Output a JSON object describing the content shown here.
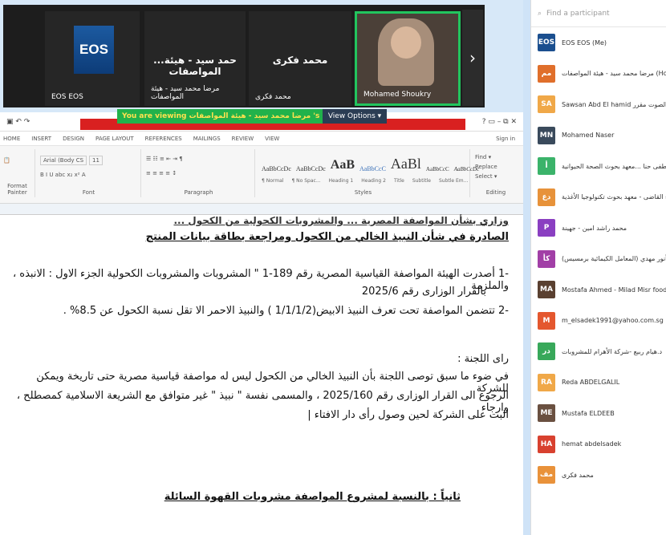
{
  "meeting": {
    "tiles": [
      {
        "name": "EOS EOS",
        "logo": "EOS"
      },
      {
        "big": "...حمد سيد - هيئة المواصفات",
        "name": "مرضا محمد سيد - هيئة المواصفات"
      },
      {
        "big": "محمد فكرى",
        "name": "محمد فكرى"
      },
      {
        "name": "Mohamed Shoukry"
      }
    ],
    "next_label": "›",
    "viewing_text": "You are viewing  مرضا محمد سيد - هيئة المواصفات 's screen",
    "view_options": "View Options ▾"
  },
  "word": {
    "signin": "Sign in",
    "tabs": [
      "HOME",
      "INSERT",
      "DESIGN",
      "PAGE LAYOUT",
      "REFERENCES",
      "MAILINGS",
      "REVIEW",
      "VIEW"
    ],
    "font_name": "Arial (Body CS",
    "font_size": "11",
    "groups": {
      "clipboard": "Format Painter",
      "font": "Font",
      "paragraph": "Paragraph",
      "styles": "Styles",
      "editing": "Editing"
    },
    "styles": [
      "AaBbCcDc",
      "AaBbCcDc",
      "AaB",
      "AaBbCcC",
      "AaBl",
      "AaBbCcC",
      "AaBbCcDc"
    ],
    "style_names": [
      "¶ Normal",
      "¶ No Spac...",
      "Heading 1",
      "Heading 2",
      "Title",
      "Subtitle",
      "Subtle Em..."
    ],
    "editing": [
      "Find ▾",
      "Replace",
      "Select ▾"
    ]
  },
  "doc": {
    "line0": "وزاري بشأن المواصفة المصرية ... والمشروبات الكحولية من الكحول ...",
    "heading1": "الصادرة في شأن النبيذ الخالي من الكحول ومراجعة بطاقة بيانات المنتج",
    "item1a": "-1  أصدرت الهيئة المواصفة القياسية المصرية رقم 189-1 \" المشروبات والمشروبات الكحولية الجزء الاول : الانبذه ، والملزمة",
    "item1b": "بالقرار الوزارى رقم 2025/6",
    "item2": "-2  تتضمن المواصفة تحت تعرف النبيذ الابيض(1/1/1/2 ) والنبيذ الاحمر الا تقل نسبة الكحول عن 8.5% .",
    "opinion": "راى اللجنة :",
    "para1": "في ضوء ما سبق توصى اللجنة بأن النبيذ الخالي من الكحول ليس له مواصفة قياسية مصرية حتى تاريخة ويمكن للشركة",
    "para2": "الرجوع الى القرار الوزارى رقم 2025/160 ، والمسمى نفسة \" نبيذ \" غير متوافق مع الشريعة الاسلامية كمصطلح ، وارجاء",
    "para3": "البت على الشركة لحين وصول رأى دار الافتاء |",
    "heading2": "ثانياً : بالنسبة لمشروع المواصفة مشروبات القهوة السائلة"
  },
  "panel": {
    "search_placeholder": "Find a participant",
    "participants": [
      {
        "initials": "EOS",
        "name": "EOS EOS (Me)",
        "color": "#1b4f8f"
      },
      {
        "initials": "مم",
        "name": "مرضا محمد سيد - هيئة المواصفات (Host)",
        "color": "#e06f2b"
      },
      {
        "initials": "SA",
        "name": "Sawsan Abd El hamid لجنة الصوت مقرر",
        "color": "#f0a848"
      },
      {
        "initials": "MN",
        "name": "Mohamed Naser",
        "color": "#3a4a5c"
      },
      {
        "initials": "أ",
        "name": "د. لطفى حنا ...معهد بحوث الصحة الحيوانية",
        "color": "#3bb36a"
      },
      {
        "initials": "دع",
        "name": "علاء القاضى - معهد بحوث تكنولوجيا الأغذية",
        "color": "#e7923a"
      },
      {
        "initials": "P",
        "name": "محمد راشد امين - جهينة",
        "color": "#8a3fc1"
      },
      {
        "initials": "كأ",
        "name": "كيماء أنور مهدي (المعامل الكيمائية برمسيس)",
        "color": "#a13fa6"
      },
      {
        "initials": "MA",
        "name": "Mostafa Ahmed - Milad Misr food Addi",
        "color": "#5a4030"
      },
      {
        "initials": "M",
        "name": "m_elsadek1991@yahoo.com.sg",
        "color": "#e4572e"
      },
      {
        "initials": "در",
        "name": "د.هيام ربيع -شركة الأهرام للمشروبات",
        "color": "#38a85a"
      },
      {
        "initials": "RA",
        "name": "Reda ABDELGALIL",
        "color": "#f0a848"
      },
      {
        "initials": "ME",
        "name": "Mustafa ELDEEB",
        "color": "#6a5040"
      },
      {
        "initials": "HA",
        "name": "hemat abdelsadek",
        "color": "#d8412f"
      },
      {
        "initials": "مف",
        "name": "محمد فكرى",
        "color": "#e9923a"
      }
    ]
  }
}
